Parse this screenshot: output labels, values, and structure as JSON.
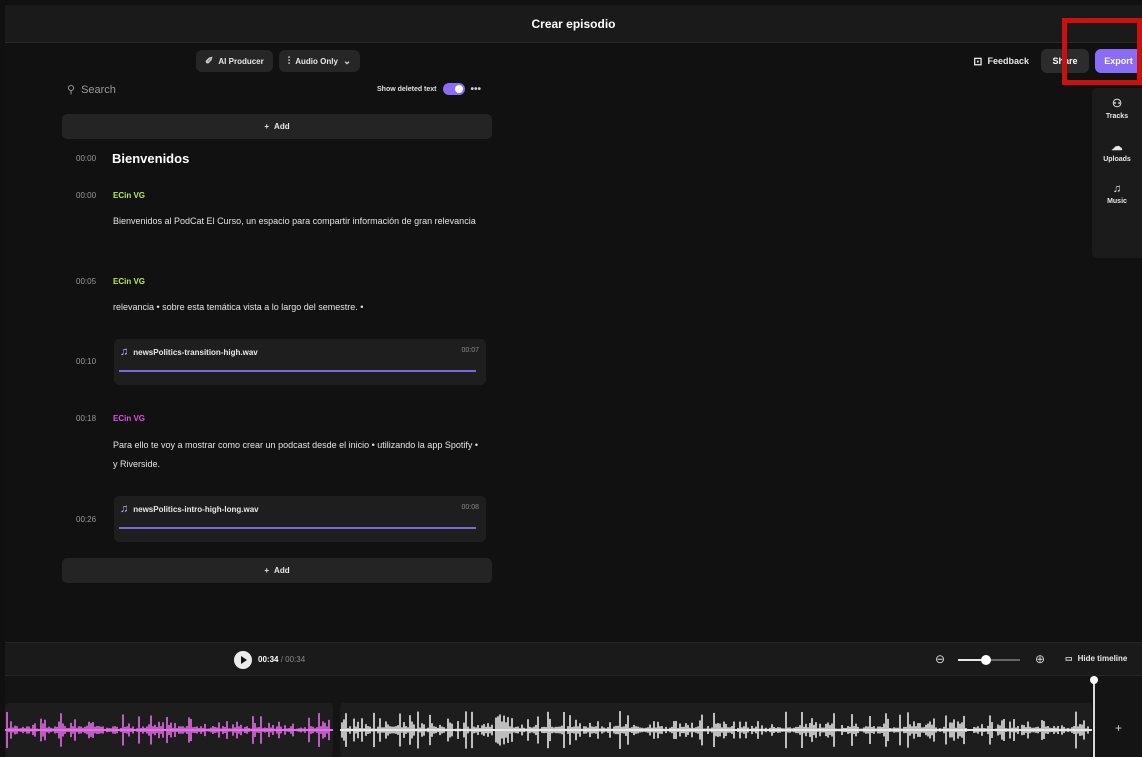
{
  "window": {
    "title": "Crear episodio",
    "close_glyph": "⌃"
  },
  "toolbar": {
    "ai_producer": "AI Producer",
    "audio_mode": "Audio Only",
    "feedback": "Feedback",
    "share": "Share",
    "export": "Export"
  },
  "transcript": {
    "search_placeholder": "Search",
    "show_deleted_label": "Show deleted text",
    "add_label": "Add",
    "heading_time": "00:00",
    "heading": "Bienvenidos",
    "segments": [
      {
        "time": "00:00",
        "speaker": "ECin VG",
        "speaker_color": "#b9e94a",
        "text": "Bienvenidos al PodCat El Curso, un espacio para compartir información de gran relevancia"
      },
      {
        "time": "00:05",
        "speaker": "ECin VG",
        "speaker_color": "#b9e94a",
        "text": "relevancia • sobre esta temática vista a lo largo del semestre. •"
      },
      {
        "time": "00:18",
        "speaker": "ECin VG",
        "speaker_color": "#e14ee6",
        "text": "Para ello te voy a mostrar como crear un podcast desde el inicio • utilizando la app Spotify • y Riverside."
      }
    ],
    "clips": [
      {
        "time": "00:10",
        "name": "newsPolitics-transition-high.wav",
        "duration": "00:07"
      },
      {
        "time": "00:26",
        "name": "newsPolitics-intro-high-long.wav",
        "duration": "00:08"
      }
    ]
  },
  "side_rail": {
    "tracks": "Tracks",
    "uploads": "Uploads",
    "music": "Music"
  },
  "transport": {
    "current_time": "00:34",
    "separator": "/",
    "total_time": "00:34",
    "zoom_level": 0.45,
    "hide_timeline": "Hide timeline"
  },
  "timeline": {
    "add_glyph": "+"
  },
  "colors": {
    "accent": "#8b6cf6",
    "pink_wave": "#e36ee8",
    "white_wave": "#e6e6e6",
    "highlight": "#cc0f0f"
  }
}
